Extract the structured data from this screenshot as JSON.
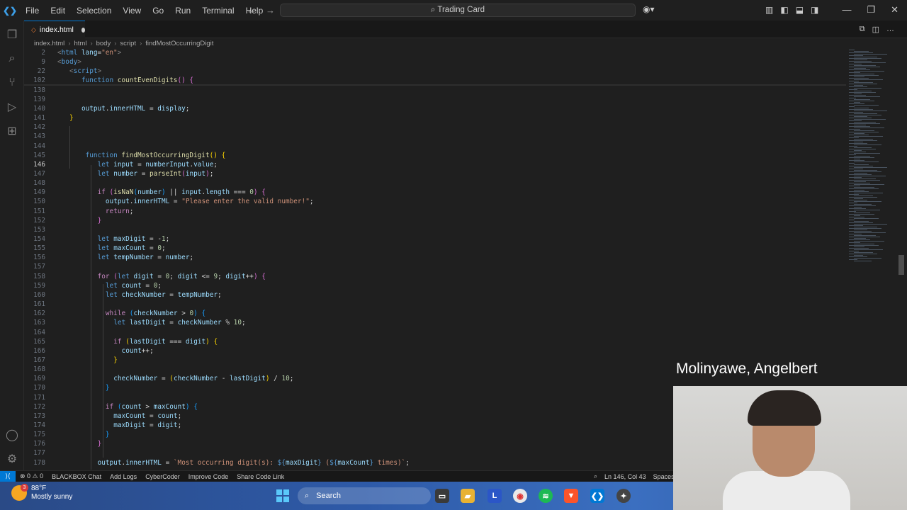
{
  "menu": [
    "File",
    "Edit",
    "Selection",
    "View",
    "Go",
    "Run",
    "Terminal",
    "Help"
  ],
  "title": "Trading Card",
  "tab": {
    "label": "index.html"
  },
  "breadcrumb": [
    "index.html",
    "html",
    "body",
    "script",
    "findMostOccurringDigit"
  ],
  "lines": [
    {
      "n": "2",
      "html": "<span class='tagp'>&lt;</span><span class='tag'>html</span> <span class='attr'>lang</span><span class='pl'>=</span><span class='str'>\"en\"</span><span class='tagp'>&gt;</span>",
      "indent": 0,
      "sticky": true
    },
    {
      "n": "9",
      "html": "<span class='tagp'>&lt;</span><span class='tag'>body</span><span class='tagp'>&gt;</span>",
      "indent": 0,
      "sticky": true
    },
    {
      "n": "22",
      "html": "<span class='tagp'>&lt;</span><span class='tag'>script</span><span class='tagp'>&gt;</span>",
      "indent": 3,
      "sticky": true
    },
    {
      "n": "102",
      "html": "<span class='kw'>function</span> <span class='fn'>countEvenDigits</span><span class='br2'>()</span> <span class='br2'>{</span>",
      "indent": 6,
      "sticky": true
    },
    {
      "n": "138",
      "html": "",
      "indent": 0
    },
    {
      "n": "139",
      "html": "",
      "indent": 0
    },
    {
      "n": "140",
      "html": "<span class='var'>output</span><span class='pl'>.</span><span class='var'>innerHTML</span> <span class='pl'>=</span> <span class='var'>display</span><span class='pl'>;</span>",
      "indent": 6
    },
    {
      "n": "141",
      "html": "<span class='br1'>}</span>",
      "indent": 3
    },
    {
      "n": "142",
      "html": "",
      "indent": 0
    },
    {
      "n": "143",
      "html": "",
      "indent": 0
    },
    {
      "n": "144",
      "html": "",
      "indent": 0
    },
    {
      "n": "145",
      "html": "<span class='kw'>function</span> <span class='fn'>findMostOccurringDigit</span><span class='br1'>()</span> <span class='br1'>{</span>",
      "indent": 7
    },
    {
      "n": "146",
      "html": "<span class='kw'>let</span> <span class='var'>input</span> <span class='pl'>=</span> <span class='var'>numberInput</span><span class='pl'>.</span><span class='var'>value</span><span class='pl'>;</span>",
      "indent": 10,
      "cur": true
    },
    {
      "n": "147",
      "html": "<span class='kw'>let</span> <span class='var'>number</span> <span class='pl'>=</span> <span class='fn'>parseInt</span><span class='br2'>(</span><span class='var'>input</span><span class='br2'>)</span><span class='pl'>;</span>",
      "indent": 10
    },
    {
      "n": "148",
      "html": "",
      "indent": 0
    },
    {
      "n": "149",
      "html": "<span class='ctl'>if</span> <span class='br2'>(</span><span class='fn'>isNaN</span><span class='br3'>(</span><span class='var'>number</span><span class='br3'>)</span> <span class='pl'>||</span> <span class='var'>input</span><span class='pl'>.</span><span class='var'>length</span> <span class='pl'>===</span> <span class='num'>0</span><span class='br2'>)</span> <span class='br2'>{</span>",
      "indent": 10
    },
    {
      "n": "150",
      "html": "<span class='var'>output</span><span class='pl'>.</span><span class='var'>innerHTML</span> <span class='pl'>=</span> <span class='str'>\"Please enter the valid number!\"</span><span class='pl'>;</span>",
      "indent": 12
    },
    {
      "n": "151",
      "html": "<span class='ctl'>return</span><span class='pl'>;</span>",
      "indent": 12
    },
    {
      "n": "152",
      "html": "<span class='br2'>}</span>",
      "indent": 10
    },
    {
      "n": "153",
      "html": "",
      "indent": 0
    },
    {
      "n": "154",
      "html": "<span class='kw'>let</span> <span class='var'>maxDigit</span> <span class='pl'>=</span> <span class='pl'>-</span><span class='num'>1</span><span class='pl'>;</span>",
      "indent": 10
    },
    {
      "n": "155",
      "html": "<span class='kw'>let</span> <span class='var'>maxCount</span> <span class='pl'>=</span> <span class='num'>0</span><span class='pl'>;</span>",
      "indent": 10
    },
    {
      "n": "156",
      "html": "<span class='kw'>let</span> <span class='var'>tempNumber</span> <span class='pl'>=</span> <span class='var'>number</span><span class='pl'>;</span>",
      "indent": 10
    },
    {
      "n": "157",
      "html": "",
      "indent": 0
    },
    {
      "n": "158",
      "html": "<span class='ctl'>for</span> <span class='br2'>(</span><span class='kw'>let</span> <span class='var'>digit</span> <span class='pl'>=</span> <span class='num'>0</span><span class='pl'>;</span> <span class='var'>digit</span> <span class='pl'>&lt;=</span> <span class='num'>9</span><span class='pl'>;</span> <span class='var'>digit</span><span class='pl'>++</span><span class='br2'>)</span> <span class='br2'>{</span>",
      "indent": 10
    },
    {
      "n": "159",
      "html": "<span class='kw'>let</span> <span class='var'>count</span> <span class='pl'>=</span> <span class='num'>0</span><span class='pl'>;</span>",
      "indent": 12
    },
    {
      "n": "160",
      "html": "<span class='kw'>let</span> <span class='var'>checkNumber</span> <span class='pl'>=</span> <span class='var'>tempNumber</span><span class='pl'>;</span>",
      "indent": 12
    },
    {
      "n": "161",
      "html": "",
      "indent": 0
    },
    {
      "n": "162",
      "html": "<span class='ctl'>while</span> <span class='br3'>(</span><span class='var'>checkNumber</span> <span class='pl'>&gt;</span> <span class='num'>0</span><span class='br3'>)</span> <span class='br3'>{</span>",
      "indent": 12
    },
    {
      "n": "163",
      "html": "<span class='kw'>let</span> <span class='var'>lastDigit</span> <span class='pl'>=</span> <span class='var'>checkNumber</span> <span class='pl'>%</span> <span class='num'>10</span><span class='pl'>;</span>",
      "indent": 14
    },
    {
      "n": "164",
      "html": "",
      "indent": 0
    },
    {
      "n": "165",
      "html": "<span class='ctl'>if</span> <span class='br1'>(</span><span class='var'>lastDigit</span> <span class='pl'>===</span> <span class='var'>digit</span><span class='br1'>)</span> <span class='br1'>{</span>",
      "indent": 14
    },
    {
      "n": "166",
      "html": "<span class='var'>count</span><span class='pl'>++;</span>",
      "indent": 16
    },
    {
      "n": "167",
      "html": "<span class='br1'>}</span>",
      "indent": 14
    },
    {
      "n": "168",
      "html": "",
      "indent": 0
    },
    {
      "n": "169",
      "html": "<span class='var'>checkNumber</span> <span class='pl'>=</span> <span class='br1'>(</span><span class='var'>checkNumber</span> <span class='pl'>-</span> <span class='var'>lastDigit</span><span class='br1'>)</span> <span class='pl'>/</span> <span class='num'>10</span><span class='pl'>;</span>",
      "indent": 14
    },
    {
      "n": "170",
      "html": "<span class='br3'>}</span>",
      "indent": 12
    },
    {
      "n": "171",
      "html": "",
      "indent": 0
    },
    {
      "n": "172",
      "html": "<span class='ctl'>if</span> <span class='br3'>(</span><span class='var'>count</span> <span class='pl'>&gt;</span> <span class='var'>maxCount</span><span class='br3'>)</span> <span class='br3'>{</span>",
      "indent": 12
    },
    {
      "n": "173",
      "html": "<span class='var'>maxCount</span> <span class='pl'>=</span> <span class='var'>count</span><span class='pl'>;</span>",
      "indent": 14
    },
    {
      "n": "174",
      "html": "<span class='var'>maxDigit</span> <span class='pl'>=</span> <span class='var'>digit</span><span class='pl'>;</span>",
      "indent": 14
    },
    {
      "n": "175",
      "html": "<span class='br3'>}</span>",
      "indent": 12
    },
    {
      "n": "176",
      "html": "<span class='br2'>}</span>",
      "indent": 10
    },
    {
      "n": "177",
      "html": "",
      "indent": 0
    },
    {
      "n": "178",
      "html": "<span class='var'>output</span><span class='pl'>.</span><span class='var'>innerHTML</span> <span class='pl'>=</span> <span class='str'>`Most occurring digit(s): </span><span class='kw'>${</span><span class='var'>maxDigit</span><span class='kw'>}</span><span class='str'> (</span><span class='kw'>${</span><span class='var'>maxCount</span><span class='kw'>}</span><span class='str'> times)`</span><span class='pl'>;</span>",
      "indent": 10
    }
  ],
  "status": {
    "problems": "⊗ 0 ⚠ 0",
    "blackbox": "BLACKBOX Chat",
    "addlogs": "Add Logs",
    "cybercoder": "CyberCoder",
    "improve": "Improve Code",
    "share": "Share Code Link",
    "position": "Ln 146, Col 43",
    "spaces": "Spaces"
  },
  "weather": {
    "temp": "88°F",
    "desc": "Mostly sunny",
    "badge": "3"
  },
  "taskbar": {
    "search": "Search"
  },
  "webcam": {
    "name": "Molinyawe, Angelbert"
  }
}
